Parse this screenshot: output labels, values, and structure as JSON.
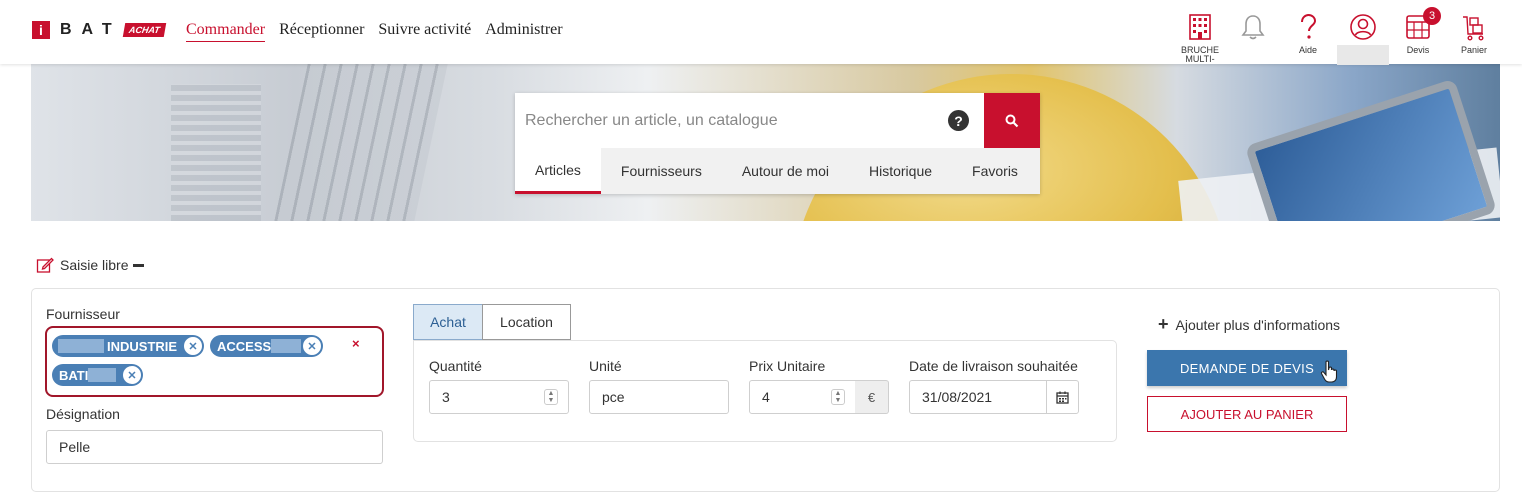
{
  "brand": {
    "logo_letter": "i",
    "logo_text": "BAT",
    "logo_tag": "ACHAT"
  },
  "nav": [
    "Commander",
    "Réceptionner",
    "Suivre activité",
    "Administrer"
  ],
  "header_icons": {
    "company_label": "BRUCHE MULTI-",
    "help_label": "Aide",
    "devis_label": "Devis",
    "devis_badge": "3",
    "panier_label": "Panier"
  },
  "search": {
    "placeholder": "Rechercher un article, un catalogue",
    "help": "?",
    "tabs": [
      "Articles",
      "Fournisseurs",
      "Autour de moi",
      "Historique",
      "Favoris"
    ]
  },
  "saisie_libre": "Saisie libre",
  "form": {
    "fournisseur_label": "Fournisseur",
    "chips": [
      "INDUSTRIE",
      "ACCESS",
      "BATI"
    ],
    "clear": "×",
    "designation_label": "Désignation",
    "designation_value": "Pelle",
    "mode_tabs": [
      "Achat",
      "Location"
    ],
    "quantite_label": "Quantité",
    "quantite_value": "3",
    "unite_label": "Unité",
    "unite_value": "pce",
    "prix_label": "Prix Unitaire",
    "prix_value": "4",
    "currency": "€",
    "date_label": "Date de livraison souhaitée",
    "date_value": "31/08/2021"
  },
  "actions": {
    "more_info": "Ajouter plus d'informations",
    "devis": "DEMANDE DE DEVIS",
    "panier": "AJOUTER AU PANIER"
  },
  "colors": {
    "brand_red": "#c8102e",
    "primary_blue": "#3b76ad",
    "chip_blue": "#4a7fb5"
  }
}
